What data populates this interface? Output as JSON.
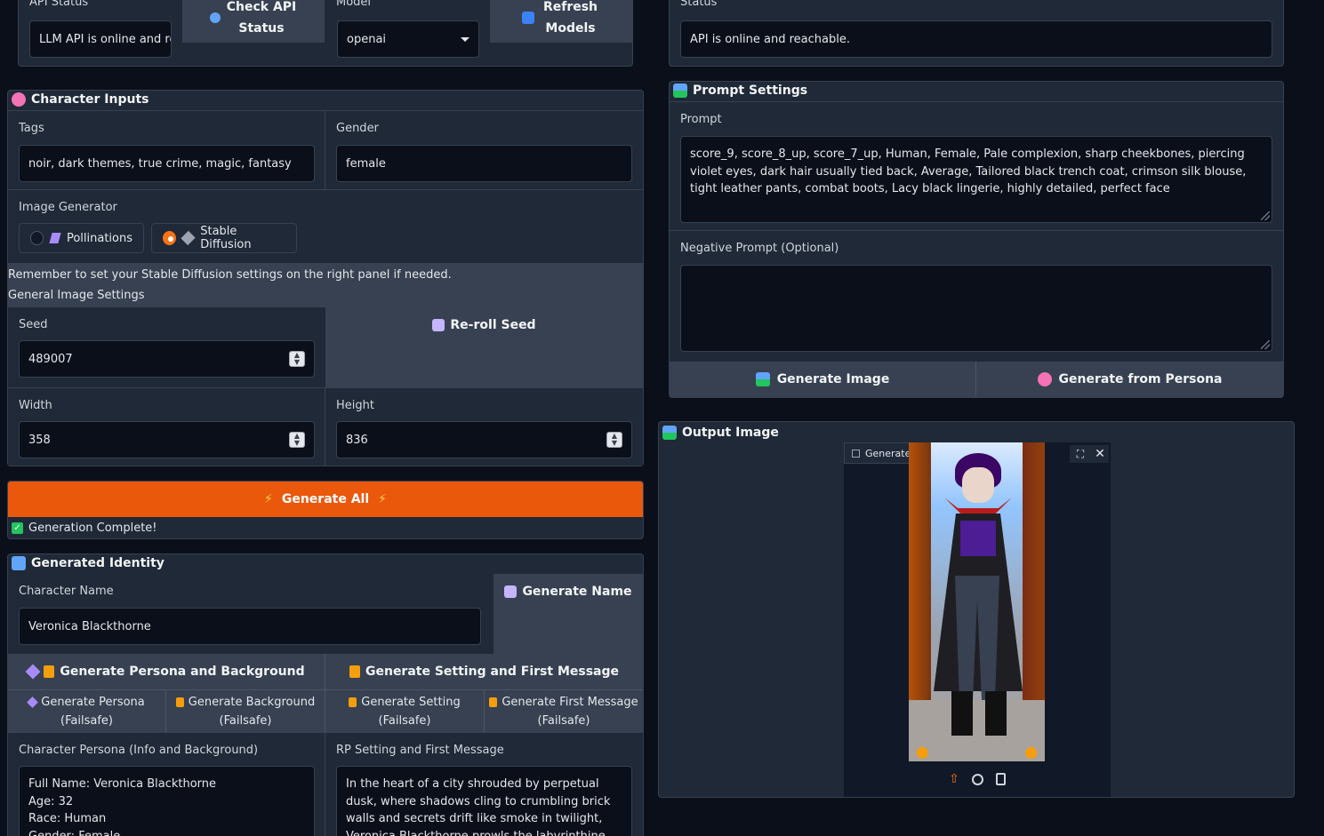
{
  "api_panel": {
    "api_status_label": "API Status",
    "api_status_value": "LLM API is online and re",
    "check_api_button": "Check API Status",
    "model_label": "Model",
    "model_value": "openai",
    "refresh_models_button": "Refresh Models"
  },
  "status_panel": {
    "status_label": "Status",
    "status_value": "API is online and reachable."
  },
  "character_inputs": {
    "title": "Character Inputs",
    "tags_label": "Tags",
    "tags_value": "noir, dark themes, true crime, magic, fantasy",
    "gender_label": "Gender",
    "gender_value": "female",
    "image_generator_label": "Image Generator",
    "generators": [
      {
        "label": "Pollinations",
        "selected": false
      },
      {
        "label": "Stable Diffusion",
        "selected": true
      }
    ],
    "reminder": "Remember to set your Stable Diffusion settings on the right panel if needed.",
    "general_settings_label": "General Image Settings",
    "seed_label": "Seed",
    "seed_value": "489007",
    "reroll_button": "Re-roll Seed",
    "width_label": "Width",
    "width_value": "358",
    "height_label": "Height",
    "height_value": "836"
  },
  "generate_all": {
    "button": "Generate All",
    "status": "Generation Complete!"
  },
  "generated_identity": {
    "title": "Generated Identity",
    "name_label": "Character Name",
    "name_value": "Veronica Blackthorne",
    "generate_name_button": "Generate Name",
    "persona_bg_button": "Generate Persona and Background",
    "setting_msg_button": "Generate Setting and First Message",
    "failsafe_buttons": [
      {
        "line1": "Generate Persona",
        "line2": "(Failsafe)"
      },
      {
        "line1": "Generate Background",
        "line2": "(Failsafe)"
      },
      {
        "line1": "Generate Setting",
        "line2": "(Failsafe)"
      },
      {
        "line1": "Generate First Message",
        "line2": "(Failsafe)"
      }
    ],
    "persona_label": "Character Persona (Info and Background)",
    "persona_lines": [
      "Full Name: Veronica Blackthorne",
      "Age: 32",
      "Race: Human",
      "Gender: Female"
    ],
    "rp_label": "RP Setting and First Message",
    "rp_text": "In the heart of a city shrouded by perpetual dusk, where shadows cling to crumbling brick walls and secrets drift like smoke in twilight, Veronica Blackthorne prowls the labyrinthine labyrinths of"
  },
  "prompt_settings": {
    "title": "Prompt Settings",
    "prompt_label": "Prompt",
    "prompt_value": "score_9, score_8_up, score_7_up, Human, Female, Pale complexion, sharp cheekbones, piercing violet eyes, dark hair usually tied back, Average, Tailored black trench coat, crimson silk blouse, tight leather pants, combat boots, Lacy black lingerie, highly detailed, perfect face",
    "negative_label": "Negative Prompt (Optional)",
    "negative_value": "",
    "generate_image_button": "Generate Image",
    "generate_persona_button": "Generate from Persona"
  },
  "output_image": {
    "title": "Output Image",
    "image_tab": "Generated Image"
  },
  "colors": {
    "accent": "#ea580c",
    "background": "#0b0f19",
    "panel": "#1f2937",
    "button": "#374151"
  }
}
